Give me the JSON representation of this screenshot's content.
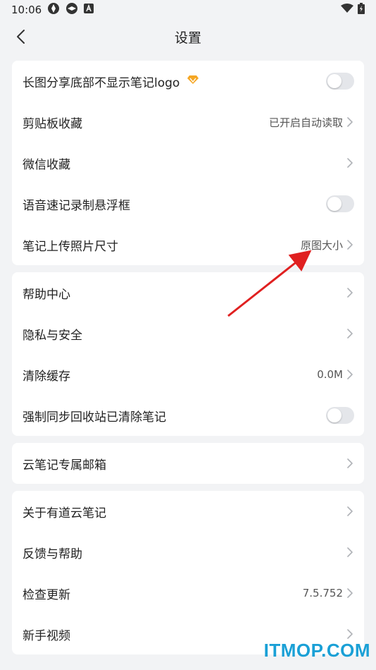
{
  "status": {
    "time": "10:06"
  },
  "header": {
    "title": "设置"
  },
  "sections": [
    {
      "rows": [
        {
          "label": "长图分享底部不显示笔记logo",
          "type": "toggle",
          "on": false,
          "vip": true
        },
        {
          "label": "剪贴板收藏",
          "type": "link",
          "value": "已开启自动读取"
        },
        {
          "label": "微信收藏",
          "type": "link",
          "value": ""
        },
        {
          "label": "语音速记录制悬浮框",
          "type": "toggle",
          "on": false
        },
        {
          "label": "笔记上传照片尺寸",
          "type": "link",
          "value": "原图大小"
        }
      ]
    },
    {
      "rows": [
        {
          "label": "帮助中心",
          "type": "link",
          "value": ""
        },
        {
          "label": "隐私与安全",
          "type": "link",
          "value": ""
        },
        {
          "label": "清除缓存",
          "type": "link",
          "value": "0.0M"
        },
        {
          "label": "强制同步回收站已清除笔记",
          "type": "toggle",
          "on": false
        }
      ]
    },
    {
      "rows": [
        {
          "label": "云笔记专属邮箱",
          "type": "link",
          "value": ""
        }
      ]
    },
    {
      "rows": [
        {
          "label": "关于有道云笔记",
          "type": "link",
          "value": ""
        },
        {
          "label": "反馈与帮助",
          "type": "link",
          "value": ""
        },
        {
          "label": "检查更新",
          "type": "link",
          "value": "7.5.752"
        },
        {
          "label": "新手视频",
          "type": "link",
          "value": ""
        }
      ]
    }
  ],
  "watermark": "ITMOP.COM",
  "colors": {
    "vip_diamond": "#f5a623",
    "arrow": "#e02020",
    "watermark": "#1aa0d6"
  }
}
